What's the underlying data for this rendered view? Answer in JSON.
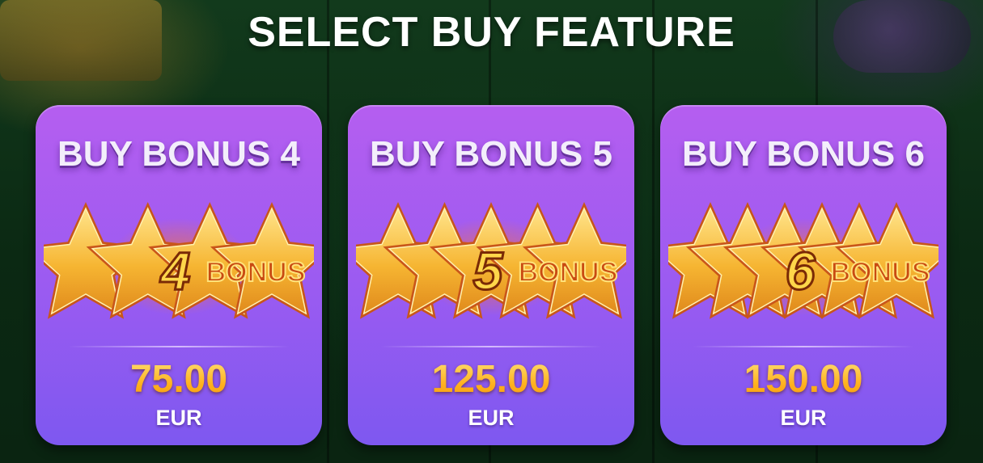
{
  "header": {
    "title": "SELECT BUY FEATURE"
  },
  "colors": {
    "card_top": "#b55ef0",
    "card_bottom": "#7e58f0",
    "price_gold": "#ffc43a",
    "star_gold": "#f6b532",
    "star_orange": "#c9561a",
    "text_white": "#ffffff"
  },
  "cards": [
    {
      "title": "BUY BONUS 4",
      "badge_number": "4",
      "badge_word": "BONUS",
      "star_count": 4,
      "price": "75.00",
      "currency": "EUR"
    },
    {
      "title": "BUY BONUS 5",
      "badge_number": "5",
      "badge_word": "BONUS",
      "star_count": 5,
      "price": "125.00",
      "currency": "EUR"
    },
    {
      "title": "BUY BONUS 6",
      "badge_number": "6",
      "badge_word": "BONUS",
      "star_count": 6,
      "price": "150.00",
      "currency": "EUR"
    }
  ]
}
